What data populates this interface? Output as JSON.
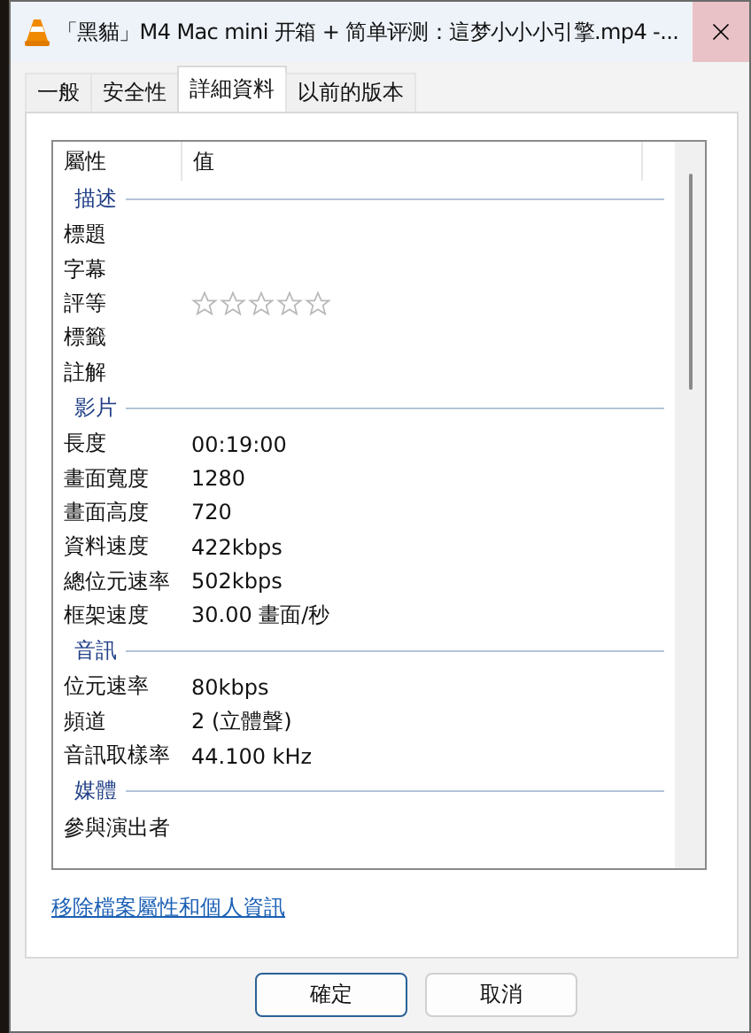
{
  "window": {
    "title": "「黑貓」M4 Mac mini 开箱 + 简单评测：這梦小小小引擎.mp4 -..."
  },
  "tabs": [
    {
      "label": "一般",
      "selected": false
    },
    {
      "label": "安全性",
      "selected": false
    },
    {
      "label": "詳細資料",
      "selected": true
    },
    {
      "label": "以前的版本",
      "selected": false
    }
  ],
  "columns": [
    "屬性",
    "值"
  ],
  "sections": [
    {
      "title": "描述",
      "rows": [
        {
          "kind": "text",
          "label": "標題"
        },
        {
          "kind": "text",
          "label": "字幕"
        },
        {
          "kind": "rating",
          "label": "評等",
          "stars": 0
        },
        {
          "kind": "text",
          "label": "標籤"
        },
        {
          "kind": "text",
          "label": "註解"
        }
      ]
    },
    {
      "title": "影片",
      "rows": [
        {
          "kind": "text",
          "label": "長度",
          "value": "00:19:00"
        },
        {
          "kind": "text",
          "label": "畫面寬度",
          "value": "1280"
        },
        {
          "kind": "text",
          "label": "畫面高度",
          "value": "720"
        },
        {
          "kind": "text",
          "label": "資料速度",
          "value": "422kbps"
        },
        {
          "kind": "text",
          "label": "總位元速率",
          "value": "502kbps"
        },
        {
          "kind": "text",
          "label": "框架速度",
          "value": "30.00 畫面/秒"
        }
      ]
    },
    {
      "title": "音訊",
      "rows": [
        {
          "kind": "text",
          "label": "位元速率",
          "value": "80kbps"
        },
        {
          "kind": "text",
          "label": "頻道",
          "value": "2 (立體聲)"
        },
        {
          "kind": "text",
          "label": "音訊取樣率",
          "value": "44.100 kHz"
        }
      ]
    },
    {
      "title": "媒體",
      "rows": [
        {
          "kind": "text",
          "label": "參與演出者"
        }
      ]
    }
  ],
  "link": "移除檔案屬性和個人資訊",
  "buttons": [
    {
      "label": "確定",
      "default": true
    },
    {
      "label": "取消",
      "default": false
    }
  ]
}
